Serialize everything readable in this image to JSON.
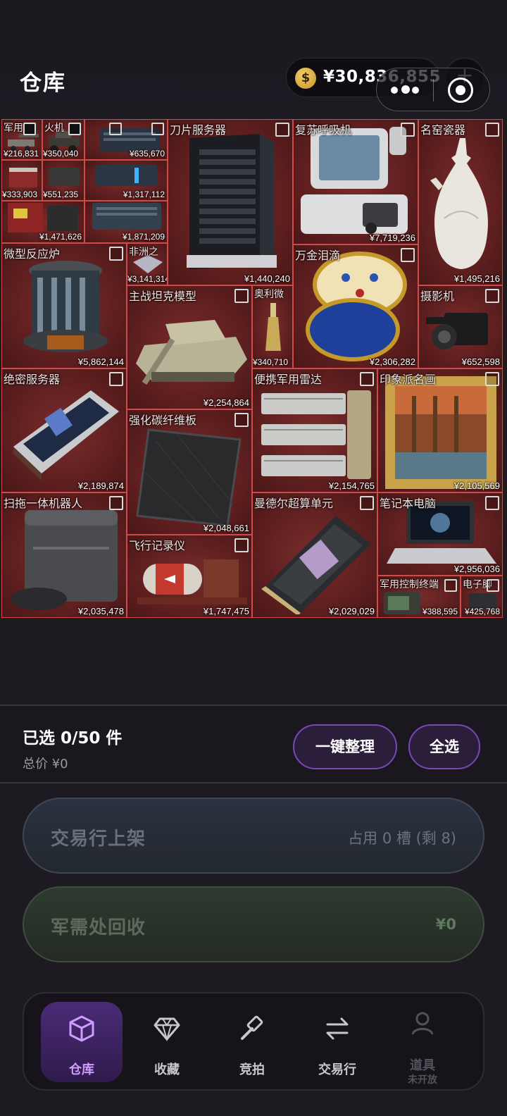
{
  "header": {
    "title": "仓库",
    "balance": "¥30,836,855",
    "coin_symbol": "$",
    "plus_label": "+"
  },
  "items": [
    {
      "name": "军用",
      "price": "¥216,831",
      "icon": "artillery-icon"
    },
    {
      "name": "火机",
      "price": "¥350,040",
      "icon": "armored-vehicle-icon"
    },
    {
      "name": "",
      "price": "¥635,670",
      "icon": "server-box-icon"
    },
    {
      "name": "",
      "price": "¥333,903",
      "icon": "toolbox-icon"
    },
    {
      "name": "",
      "price": "¥551,235",
      "icon": "case-icon"
    },
    {
      "name": "",
      "price": "¥1,317,112",
      "icon": "battery-icon"
    },
    {
      "name": "",
      "price": "¥1,471,626",
      "icon": "crate-icon"
    },
    {
      "name": "",
      "price": "¥1,871,209",
      "icon": "rack-icon"
    },
    {
      "name": "刀片服务器",
      "price": "¥1,440,240",
      "icon": "blade-server-icon"
    },
    {
      "name": "复苏呼吸机",
      "price": "¥7,719,236",
      "icon": "ventilator-icon"
    },
    {
      "name": "名窑瓷器",
      "price": "¥1,495,216",
      "icon": "porcelain-vase-icon"
    },
    {
      "name": "微型反应炉",
      "price": "¥5,862,144",
      "icon": "reactor-icon"
    },
    {
      "name": "非洲之",
      "price": "¥3,141,314",
      "icon": "diamond-icon"
    },
    {
      "name": "万金泪滴",
      "price": "¥2,306,282",
      "icon": "jeweled-egg-icon"
    },
    {
      "name": "主战坦克模型",
      "price": "¥2,254,864",
      "icon": "tank-icon"
    },
    {
      "name": "奥利微",
      "price": "¥340,710",
      "icon": "bottle-icon"
    },
    {
      "name": "摄影机",
      "price": "¥652,598",
      "icon": "camera-icon"
    },
    {
      "name": "绝密服务器",
      "price": "¥2,189,874",
      "icon": "open-server-icon"
    },
    {
      "name": "便携军用雷达",
      "price": "¥2,154,765",
      "icon": "radar-icon"
    },
    {
      "name": "印象派名画",
      "price": "¥2,105,569",
      "icon": "painting-icon"
    },
    {
      "name": "强化碳纤维板",
      "price": "¥2,048,661",
      "icon": "carbon-plate-icon"
    },
    {
      "name": "扫拖一体机器人",
      "price": "¥2,035,478",
      "icon": "mop-robot-icon"
    },
    {
      "name": "曼德尔超算单元",
      "price": "¥2,029,029",
      "icon": "gpu-icon"
    },
    {
      "name": "笔记本电脑",
      "price": "¥2,956,036",
      "icon": "laptop-icon"
    },
    {
      "name": "飞行记录仪",
      "price": "¥1,747,475",
      "icon": "flight-recorder-icon"
    },
    {
      "name": "军用控制终端",
      "price": "¥388,595",
      "icon": "terminal-icon"
    },
    {
      "name": "电子脚",
      "price": "¥425,768",
      "icon": "device-icon"
    }
  ],
  "summary": {
    "selected": "已选 0/50 件",
    "total": "总价  ¥0",
    "organize_label": "一键整理",
    "select_all_label": "全选"
  },
  "actions": {
    "market": {
      "label": "交易行上架",
      "info": "占用 0 槽 (剩 8)"
    },
    "recycle": {
      "label": "军需处回收",
      "value": "¥0"
    }
  },
  "nav": [
    {
      "label": "仓库",
      "icon": "cube-icon",
      "active": true
    },
    {
      "label": "收藏",
      "icon": "diamond-icon"
    },
    {
      "label": "竞拍",
      "icon": "hammer-icon"
    },
    {
      "label": "交易行",
      "icon": "swap-icon"
    },
    {
      "label": "道具",
      "sub": "未开放",
      "icon": "user-icon",
      "disabled": true
    }
  ],
  "colors": {
    "cell_border": "#d14a4a",
    "cell_fill": "#5a1d1d",
    "accent": "#7a46b8",
    "active_label": "#cf9cff"
  }
}
